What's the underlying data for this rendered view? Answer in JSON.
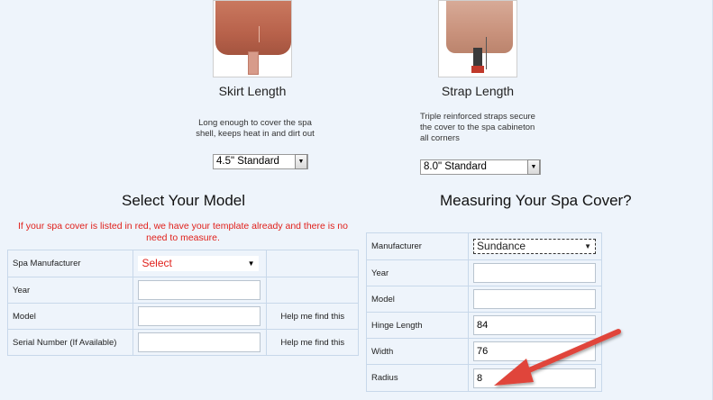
{
  "skirt": {
    "title": "Skirt Length",
    "description_line1": "Long enough to cover the spa",
    "description_line2": "shell, keeps heat in and dirt out",
    "selected": "4.5\" Standard"
  },
  "strap": {
    "title": "Strap Length",
    "description_line1": "Triple reinforced straps secure",
    "description_line2": "the cover to the spa cabineton",
    "description_line3": "all corners",
    "selected": "8.0\" Standard"
  },
  "model_section": {
    "title": "Select Your Model",
    "note": "If your spa cover is listed in red, we have your template already and there is no need to measure.",
    "rows": [
      {
        "label": "Spa Manufacturer",
        "value": "Select",
        "help": ""
      },
      {
        "label": "Year",
        "value": "",
        "help": ""
      },
      {
        "label": "Model",
        "value": "",
        "help": "Help me find this"
      },
      {
        "label": "Serial Number (If Available)",
        "value": "",
        "help": "Help me find this"
      }
    ]
  },
  "measure_section": {
    "title": "Measuring Your Spa Cover?",
    "rows": [
      {
        "label": "Manufacturer",
        "value": "Sundance"
      },
      {
        "label": "Year",
        "value": ""
      },
      {
        "label": "Model",
        "value": ""
      },
      {
        "label": "Hinge Length",
        "value": "84"
      },
      {
        "label": "Width",
        "value": "76"
      },
      {
        "label": "Radius",
        "value": "8"
      }
    ]
  },
  "colors": {
    "background": "#eef4fb",
    "note_red": "#e0201b",
    "link_blue": "#2a66b5",
    "arrow": "#e0453a"
  },
  "icons": [
    "dropdown-arrow-icon",
    "red-arrow-annotation"
  ]
}
